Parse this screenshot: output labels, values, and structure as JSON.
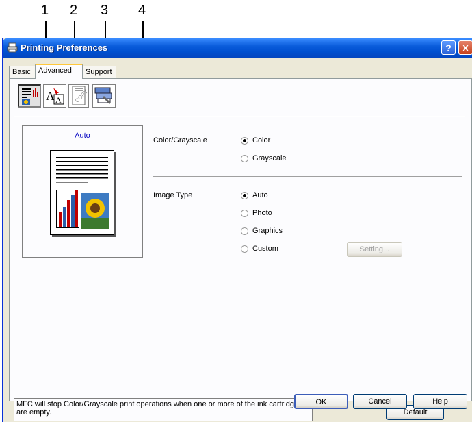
{
  "callouts": [
    "1",
    "2",
    "3",
    "4"
  ],
  "window": {
    "title": "Printing Preferences",
    "help_button": "?",
    "close_button": "X"
  },
  "tabs": [
    {
      "label": "Basic",
      "active": false
    },
    {
      "label": "Advanced",
      "active": true
    },
    {
      "label": "Support",
      "active": false
    }
  ],
  "toolbar": {
    "icons": [
      "print-quality-icon",
      "font-icon",
      "watermark-icon",
      "device-options-icon"
    ]
  },
  "preview": {
    "label": "Auto"
  },
  "color_grayscale": {
    "label": "Color/Grayscale",
    "options": [
      {
        "label": "Color",
        "checked": true
      },
      {
        "label": "Grayscale",
        "checked": false
      }
    ]
  },
  "image_type": {
    "label": "Image Type",
    "options": [
      {
        "label": "Auto",
        "checked": true
      },
      {
        "label": "Photo",
        "checked": false
      },
      {
        "label": "Graphics",
        "checked": false
      },
      {
        "label": "Custom",
        "checked": false
      }
    ],
    "setting_button": "Setting..."
  },
  "message": "MFC will stop Color/Grayscale print operations when one or more of the ink cartridges are empty.",
  "buttons": {
    "default": "Default",
    "ok": "OK",
    "cancel": "Cancel",
    "help": "Help"
  },
  "colors": {
    "title_bar": "#0A5CDB",
    "dialog_bg": "#ECE9D8",
    "preview_label": "#0000C0"
  }
}
